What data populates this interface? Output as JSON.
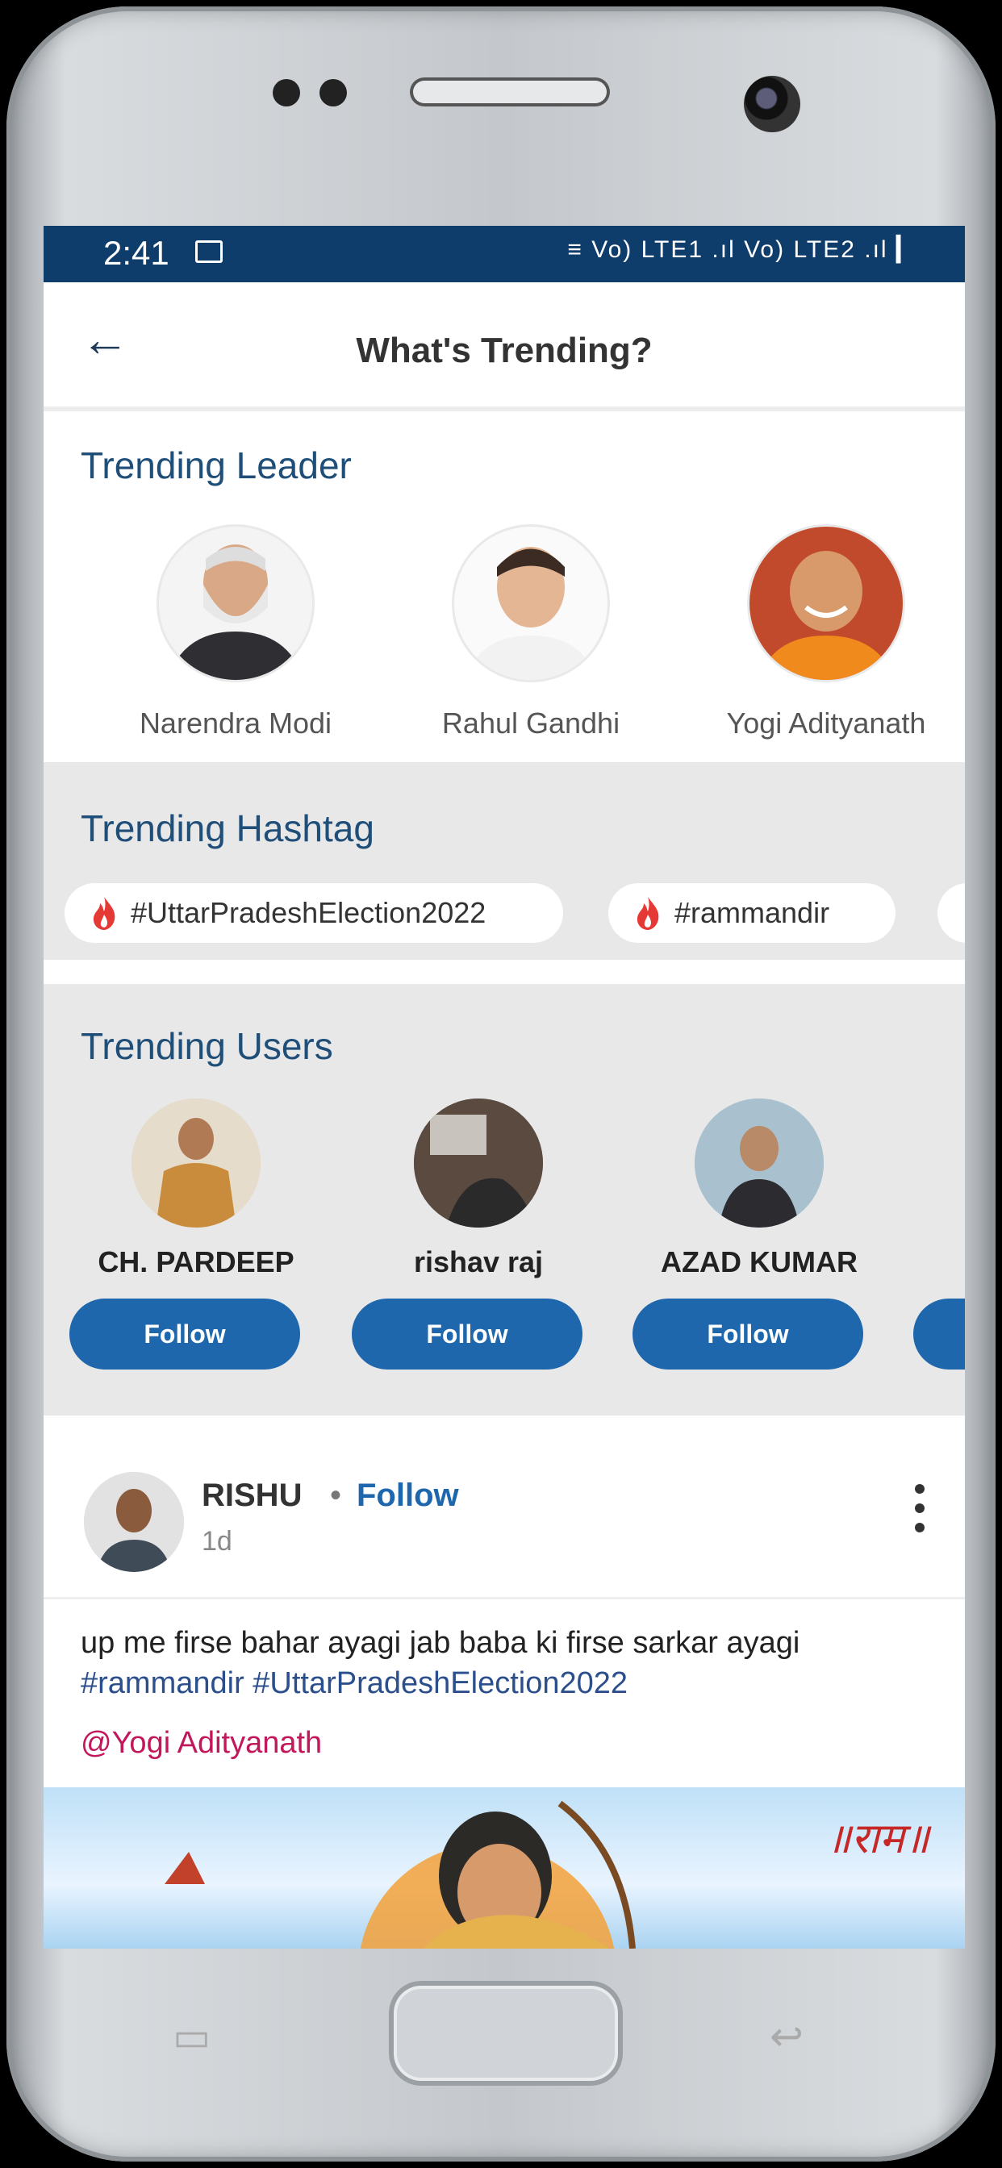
{
  "status_bar": {
    "time": "2:41",
    "icons": "≡ Vo) LTE1 .ıl Vo) LTE2 .ıl ▎"
  },
  "header": {
    "title": "What's Trending?"
  },
  "leaders": {
    "title": "Trending Leader",
    "items": [
      {
        "name": "Narendra Modi"
      },
      {
        "name": "Rahul Gandhi"
      },
      {
        "name": "Yogi Adityanath"
      }
    ]
  },
  "hashtags": {
    "title": "Trending Hashtag",
    "items": [
      "#UttarPradeshElection2022",
      "#rammandir"
    ]
  },
  "users": {
    "title": "Trending Users",
    "items": [
      {
        "name": "CH. PARDEEP",
        "button": "Follow"
      },
      {
        "name": "rishav raj",
        "button": "Follow"
      },
      {
        "name": "AZAD KUMAR",
        "button": "Follow"
      }
    ]
  },
  "post": {
    "author": "RISHU",
    "follow": "Follow",
    "time": "1d",
    "text": "up me firse bahar ayagi jab baba ki firse sarkar ayagi",
    "tags": "#rammandir #UttarPradeshElection2022",
    "mention": "@Yogi Adityanath",
    "banner_text": "॥राम॥"
  },
  "colors": {
    "accent": "#1e67ad",
    "status": "#0f3d6b",
    "mention": "#c2185b"
  }
}
